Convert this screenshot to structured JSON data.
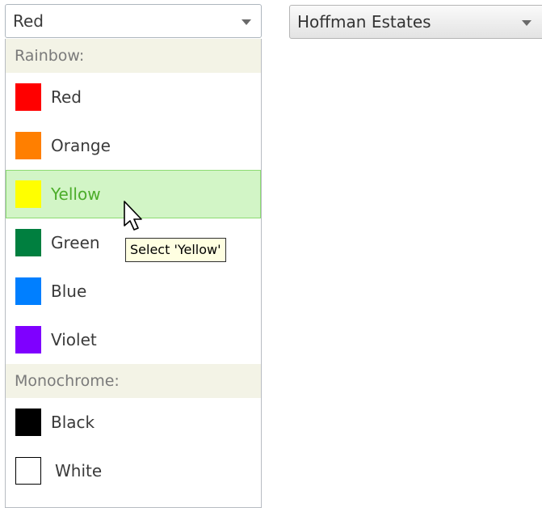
{
  "color_combo": {
    "selected": "Red"
  },
  "city_combo": {
    "selected": "Hoffman Estates"
  },
  "dropdown": {
    "groups": [
      {
        "header": "Rainbow:",
        "items": [
          {
            "label": "Red",
            "color": "#ff0000"
          },
          {
            "label": "Orange",
            "color": "#ff7f00"
          },
          {
            "label": "Yellow",
            "color": "#ffff00",
            "highlighted": true
          },
          {
            "label": "Green",
            "color": "#007f3f"
          },
          {
            "label": "Blue",
            "color": "#007fff"
          },
          {
            "label": "Violet",
            "color": "#7f00ff"
          }
        ]
      },
      {
        "header": "Monochrome:",
        "items": [
          {
            "label": "Black",
            "color": "#000000"
          },
          {
            "label": "White",
            "color": "#ffffff"
          }
        ]
      }
    ]
  },
  "tooltip": {
    "text": "Select 'Yellow'"
  },
  "cursor": {
    "icon": "arrow-pointer-icon"
  }
}
